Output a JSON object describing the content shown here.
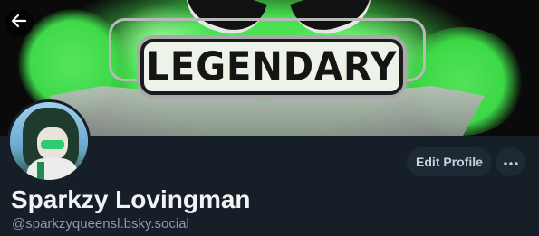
{
  "banner": {
    "title_text": "LEGENDARY",
    "star_glyph": "★",
    "back_icon": "arrow-left-icon"
  },
  "profile": {
    "display_name": "Sparkzy Lovingman",
    "handle": "@sparkzyqueensl.bsky.social",
    "edit_button_label": "Edit Profile",
    "more_icon": "ellipsis-icon"
  },
  "colors": {
    "background": "#161e27",
    "button_bg": "#1e2936",
    "banner_green": "#47e04f",
    "name_text": "#f1f3f5",
    "handle_text": "#8d9aa8"
  }
}
